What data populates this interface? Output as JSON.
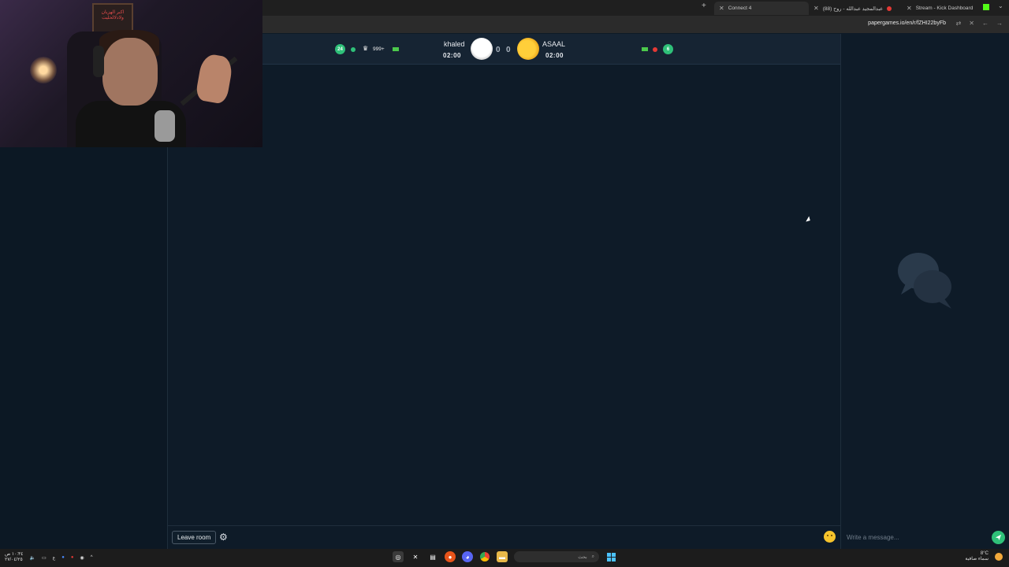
{
  "browser": {
    "tabs": [
      {
        "label": "Connect 4",
        "active": true
      },
      {
        "label": "(88) عبدالمجيد عبدالله - روح",
        "active": false
      },
      {
        "label": "Stream - Kick Dashboard",
        "active": false
      }
    ],
    "url": "papergames.io/en/r/fZHI22byFb"
  },
  "game": {
    "left_badge": "24",
    "rank_label": "999+",
    "player1": {
      "name": "khaled",
      "time": "02:00"
    },
    "player2": {
      "name": "ASAAL",
      "time": "02:00"
    },
    "score_p1": "0",
    "score_p2": "0",
    "right_badge": "6",
    "leave_label": "Leave room"
  },
  "chat": {
    "placeholder": "Write a message..."
  },
  "webcam": {
    "poster_text": "اكبر الهزيان ولادلالحليت"
  },
  "taskbar": {
    "search_text": "بحث",
    "weather_temp": "8°C",
    "weather_text": "سماء صافية",
    "clock_time": "١٠:٣٤ ص",
    "clock_date": "٢٧/٠٤/٢٥"
  },
  "colors": {
    "accent_green": "#2fc079",
    "background": "#0e1b28",
    "header": "#162433"
  }
}
